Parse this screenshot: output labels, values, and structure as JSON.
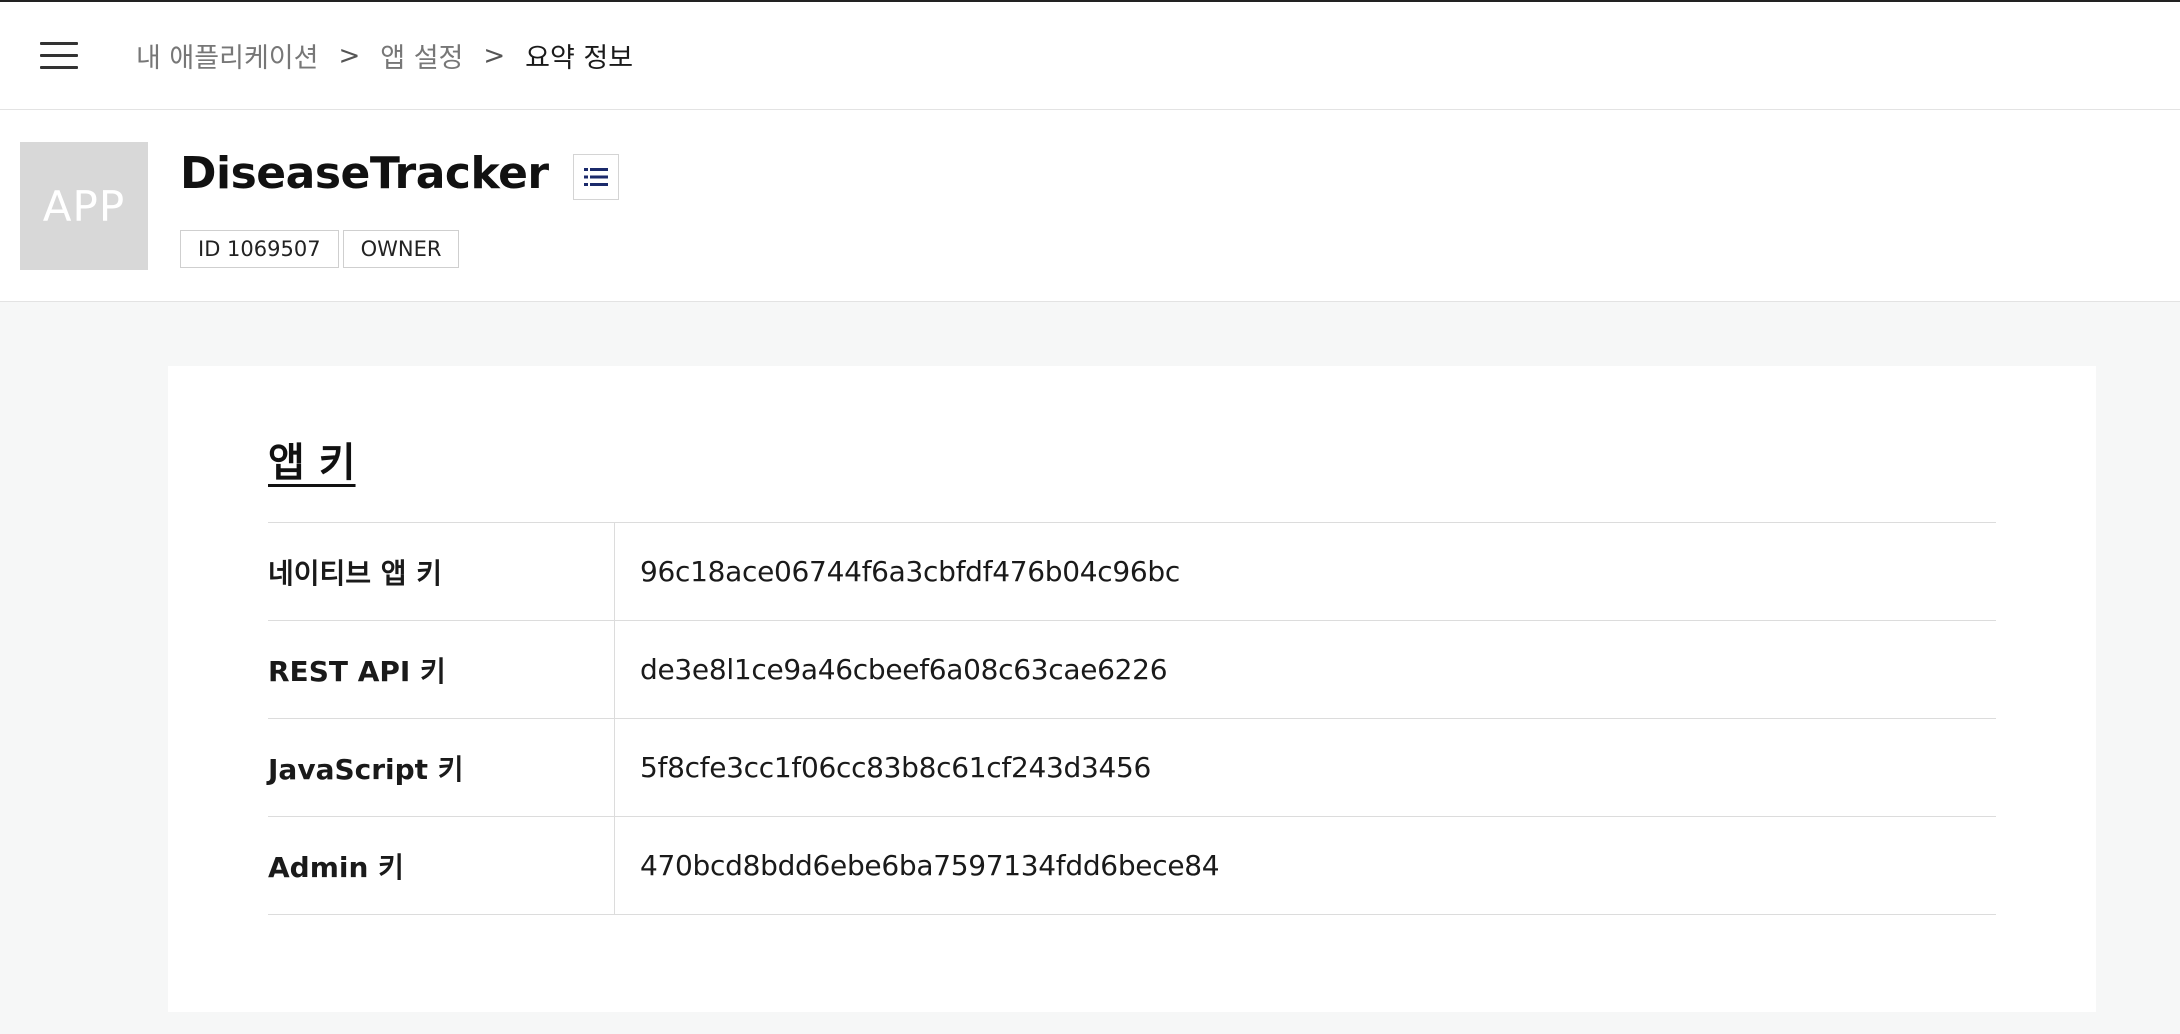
{
  "breadcrumb": {
    "items": [
      "내 애플리케이션",
      "앱 설정",
      "요약 정보"
    ],
    "separator": ">"
  },
  "app": {
    "avatar_text": "APP",
    "name": "DiseaseTracker",
    "badges": [
      "ID 1069507",
      "OWNER"
    ]
  },
  "icons": {
    "menu": "hamburger-menu-icon",
    "list": "list-icon"
  },
  "colors": {
    "list_icon": "#1b2a6b",
    "avatar_bg": "#d8d8d8",
    "page_bg": "#f6f7f7"
  },
  "app_keys": {
    "title": "앱 키",
    "rows": [
      {
        "label": "네이티브 앱 키",
        "value": "96c18ace06744f6a3cbfdf476b04c96bc"
      },
      {
        "label": "REST API 키",
        "value": "de3e8l1ce9a46cbeef6a08c63cae6226"
      },
      {
        "label": "JavaScript 키",
        "value": "5f8cfe3cc1f06cc83b8c61cf243d3456"
      },
      {
        "label": "Admin 키",
        "value": "470bcd8bdd6ebe6ba7597134fdd6bece84"
      }
    ]
  }
}
